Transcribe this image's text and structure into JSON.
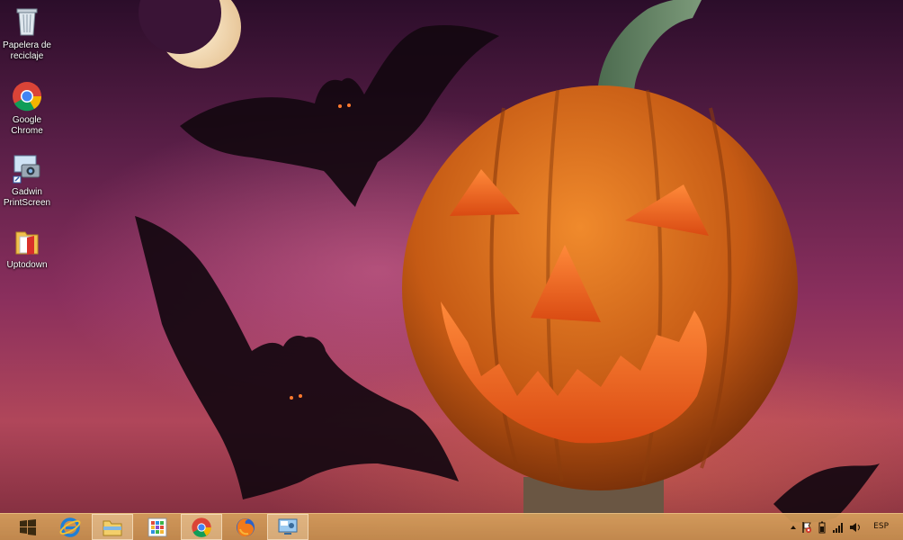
{
  "desktop": {
    "icons": [
      {
        "label": "Papelera de reciclaje",
        "icon": "recycle-bin-icon"
      },
      {
        "label": "Google Chrome",
        "icon": "chrome-icon"
      },
      {
        "label": "Gadwin PrintScreen",
        "icon": "printscreen-camera-icon"
      },
      {
        "label": "Uptodown",
        "icon": "folder-icon"
      }
    ]
  },
  "taskbar": {
    "items": [
      {
        "icon": "windows-start-icon"
      },
      {
        "icon": "internet-explorer-icon"
      },
      {
        "icon": "file-explorer-icon",
        "active": true
      },
      {
        "icon": "apps-grid-icon"
      },
      {
        "icon": "chrome-icon",
        "active": true
      },
      {
        "icon": "firefox-icon"
      },
      {
        "icon": "remote-desktop-icon",
        "active": true
      }
    ],
    "tray": {
      "language": "ESP",
      "icons": [
        "show-hidden-icons-chevron-icon",
        "action-center-flag-icon",
        "battery-icon",
        "network-signal-icon",
        "volume-icon"
      ]
    }
  },
  "colors": {
    "taskbar": "#c98f4f",
    "sky_top": "#2b0d2a",
    "sky_bottom": "#b0465a",
    "pumpkin": "#d9741f"
  }
}
